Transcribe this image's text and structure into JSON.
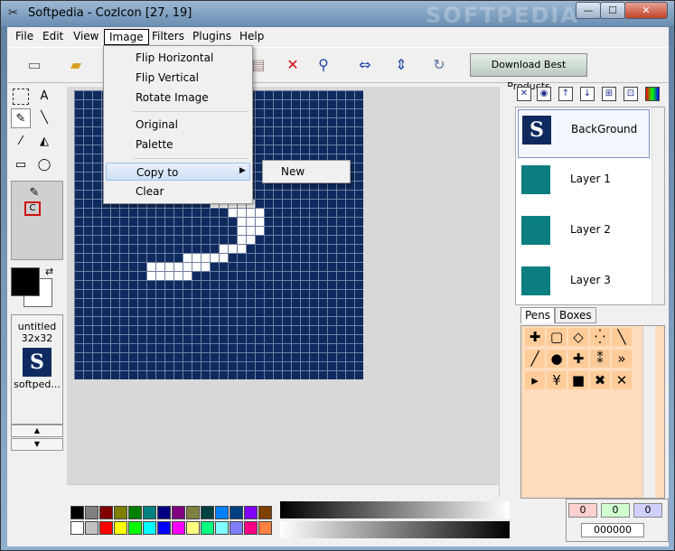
{
  "window": {
    "title": "Softpedia - CozIcon [27, 19]",
    "watermark": "SOFTPEDIA",
    "min_glyph": "—",
    "max_glyph": "☐",
    "close_glyph": "✕"
  },
  "menubar": {
    "items": [
      "File",
      "Edit",
      "View",
      "Image",
      "Filters",
      "Plugins",
      "Help"
    ]
  },
  "image_menu": {
    "items": [
      "Flip Horizontal",
      "Flip Vertical",
      "Rotate Image",
      "Original",
      "Palette",
      "Copy to",
      "Clear"
    ],
    "submenu_arrow": "▶",
    "copy_to_submenu": [
      "New"
    ]
  },
  "toolbar": {
    "download_button": "Download Best Products"
  },
  "tools": {
    "text_tool": "A"
  },
  "image_list": {
    "name": "untitled",
    "size": "32x32",
    "thumb_letter": "S",
    "file": "softped..."
  },
  "layers": {
    "items": [
      {
        "name": "BackGround",
        "thumb": "S"
      },
      {
        "name": "Layer 1",
        "thumb": ""
      },
      {
        "name": "Layer 2",
        "thumb": ""
      },
      {
        "name": "Layer 3",
        "thumb": ""
      }
    ]
  },
  "tabs": [
    "Pens",
    "Boxes"
  ],
  "color_readout": {
    "r": "0",
    "g": "0",
    "b": "0",
    "hex": "000000"
  },
  "colors": {
    "accent": "#0f2a5f",
    "layer_teal": "#0a7e80",
    "pens_bg": "#ffdcbc"
  }
}
